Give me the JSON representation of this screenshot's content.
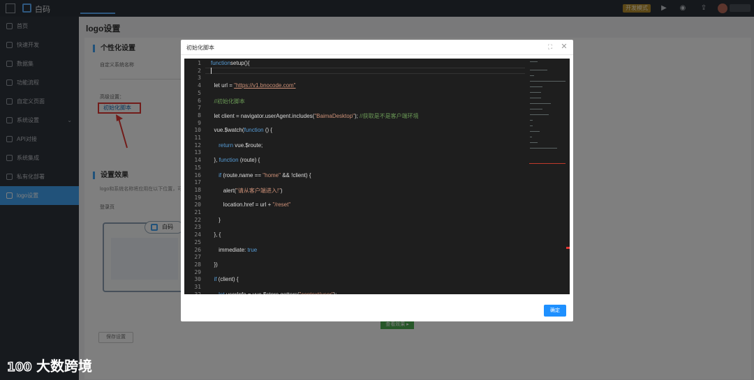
{
  "app": {
    "logo_text": "白码",
    "dev_badge": "开发模式"
  },
  "sidebar": {
    "items": [
      {
        "label": "首页"
      },
      {
        "label": "快速开发"
      },
      {
        "label": "数据集"
      },
      {
        "label": "功能流程"
      },
      {
        "label": "自定义页面"
      },
      {
        "label": "系统设置"
      },
      {
        "label": "API对接"
      },
      {
        "label": "系统集成"
      },
      {
        "label": "私有化部署"
      },
      {
        "label": "logo设置"
      }
    ],
    "active_index": 9
  },
  "page": {
    "title": "logo设置",
    "section_personal": "个性化设置",
    "field_custom_name": "自定义系统名称",
    "field_advanced": "高级设置：",
    "init_script_link": "初始化脚本",
    "section_effect": "设置效果",
    "hint": "logo和系统名称将应用在以下位置，可…",
    "preview_label": "登录页",
    "preview_chip": "白码",
    "save_button": "保存设置",
    "view_button": "查看效果 ▸"
  },
  "modal": {
    "title": "初始化脚本",
    "ok_button": "确定"
  },
  "code": {
    "line_numbers": [
      "1",
      "2",
      "3",
      "4",
      "5",
      "6",
      "7",
      "8",
      "9",
      "10",
      "11",
      "12",
      "13",
      "14",
      "15",
      "16",
      "17",
      "18",
      "19",
      "20",
      "21",
      "22",
      "23",
      "24",
      "25",
      "26",
      "27",
      "28",
      "29",
      "30",
      "31",
      "32"
    ],
    "lines": [
      {
        "segs": [
          [
            "kw",
            "function"
          ],
          [
            "",
            "setup(){"
          ]
        ]
      },
      {
        "segs": []
      },
      {
        "segs": []
      },
      {
        "segs": [
          [
            "",
            "  let url = "
          ],
          [
            "lnk",
            "\"https://v1.bnocode.com\""
          ]
        ]
      },
      {
        "segs": []
      },
      {
        "segs": [
          [
            "cm",
            "  //初始化脚本"
          ]
        ]
      },
      {
        "segs": []
      },
      {
        "segs": [
          [
            "",
            "  let client = navigator.userAgent.includes("
          ],
          [
            "str",
            "\"BaimaDesktop\""
          ],
          [
            "",
            "); "
          ],
          [
            "cm",
            "//获取是不是客户端环境"
          ]
        ]
      },
      {
        "segs": []
      },
      {
        "segs": [
          [
            "",
            "  vue.$watch("
          ],
          [
            "kw",
            "function"
          ],
          [
            "",
            " () {"
          ]
        ]
      },
      {
        "segs": []
      },
      {
        "segs": [
          [
            "",
            "     "
          ],
          [
            "kw",
            "return"
          ],
          [
            "",
            " vue.$route;"
          ]
        ]
      },
      {
        "segs": []
      },
      {
        "segs": [
          [
            "",
            "  }, "
          ],
          [
            "kw",
            "function"
          ],
          [
            "",
            " (route) {"
          ]
        ]
      },
      {
        "segs": []
      },
      {
        "segs": [
          [
            "",
            "     "
          ],
          [
            "kw",
            "if"
          ],
          [
            "",
            " (route.name == "
          ],
          [
            "str",
            "\"home\""
          ],
          [
            "",
            " && !client) {"
          ]
        ]
      },
      {
        "segs": []
      },
      {
        "segs": [
          [
            "",
            "        alert("
          ],
          [
            "str",
            "\"请从客户端进入!\""
          ],
          [
            "",
            ")"
          ]
        ]
      },
      {
        "segs": []
      },
      {
        "segs": [
          [
            "",
            "        location.href = url + "
          ],
          [
            "str",
            "\"/reset\""
          ]
        ]
      },
      {
        "segs": []
      },
      {
        "segs": [
          [
            "",
            "     }"
          ]
        ]
      },
      {
        "segs": []
      },
      {
        "segs": [
          [
            "",
            "  }, {"
          ]
        ]
      },
      {
        "segs": []
      },
      {
        "segs": [
          [
            "",
            "     immediate: "
          ],
          [
            "kw",
            "true"
          ]
        ]
      },
      {
        "segs": []
      },
      {
        "segs": [
          [
            "",
            "  })"
          ]
        ]
      },
      {
        "segs": []
      },
      {
        "segs": [
          [
            "",
            "  "
          ],
          [
            "kw",
            "if"
          ],
          [
            "",
            " (client) {"
          ]
        ]
      },
      {
        "segs": []
      },
      {
        "segs": [
          [
            "",
            "     "
          ],
          [
            "kw",
            "let"
          ],
          [
            "",
            " userInfo = vue.$store.getters("
          ],
          [
            "str",
            "\"context/user\""
          ],
          [
            "",
            ");"
          ]
        ]
      }
    ]
  },
  "watermark": {
    "text": "大数跨境",
    "logo_text": "100"
  }
}
